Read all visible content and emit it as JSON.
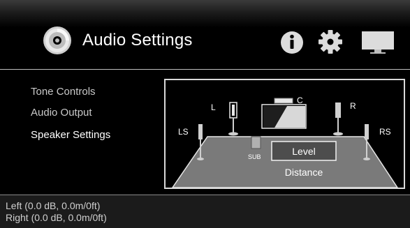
{
  "header": {
    "title": "Audio Settings",
    "app_icon": "disc-icon",
    "buttons": [
      {
        "name": "info-icon",
        "label": "i"
      },
      {
        "name": "gear-icon"
      },
      {
        "name": "display-icon"
      }
    ]
  },
  "menu": {
    "items": [
      {
        "label": "Tone Controls",
        "active": false
      },
      {
        "label": "Audio Output",
        "active": false
      },
      {
        "label": "Speaker Settings",
        "active": true
      }
    ]
  },
  "speaker_diagram": {
    "labels": {
      "left": "L",
      "center": "C",
      "right": "R",
      "left_surround": "LS",
      "right_surround": "RS",
      "subwoofer": "SUB"
    },
    "level_button": "Level",
    "distance_label": "Distance"
  },
  "status": {
    "lines": [
      "Left (0.0 dB, 0.0m/0ft)",
      "Right (0.0 dB, 0.0m/0ft)"
    ]
  },
  "colors": {
    "background": "#000000",
    "text": "#ffffff",
    "menu_inactive": "#c9c9c9",
    "floor": "#7a7a7a"
  }
}
